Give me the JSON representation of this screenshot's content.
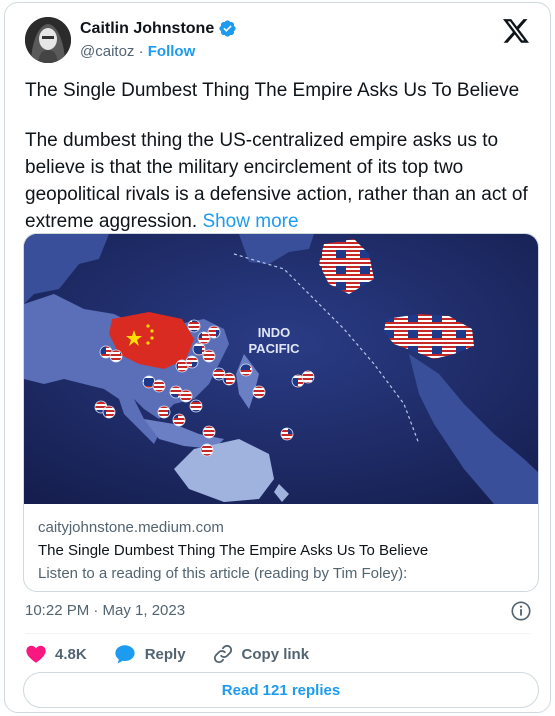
{
  "author": {
    "name": "Caitlin Johnstone",
    "handle": "@caitoz",
    "separator": "·",
    "follow_label": "Follow"
  },
  "tweet": {
    "title": "The Single Dumbest Thing The Empire Asks Us To Believe",
    "body": "The dumbest thing the US-centralized empire asks us to believe is that the military encirclement of its top two geopolitical rivals is a defensive action, rather than an act of extreme aggression.",
    "show_more_label": "Show more"
  },
  "link_card": {
    "image_label_line1": "INDO",
    "image_label_line2": "PACIFIC",
    "domain": "caityjohnstone.medium.com",
    "title": "The Single Dumbest Thing The Empire Asks Us To Believe",
    "description": "Listen to a reading of this article (reading by Tim Foley):"
  },
  "timestamp": "10:22 PM · May 1, 2023",
  "actions": {
    "likes": "4.8K",
    "reply_label": "Reply",
    "copy_link_label": "Copy link"
  },
  "read_replies_label": "Read 121 replies",
  "icons": [
    "verified-badge-icon",
    "x-logo-icon",
    "info-icon",
    "heart-icon",
    "reply-bubble-icon",
    "link-icon"
  ],
  "colors": {
    "accent": "#1d9bf0",
    "heart": "#f91880",
    "secondary_text": "#536471",
    "border": "#cfd9de"
  }
}
